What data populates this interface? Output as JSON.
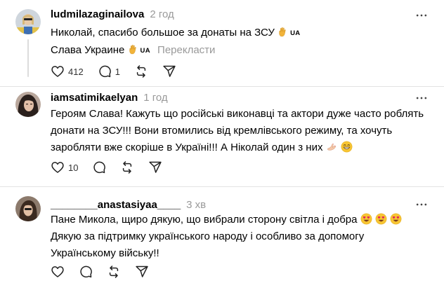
{
  "comments": [
    {
      "username": "ludmilazaginailova",
      "time": "2 год",
      "lines": [
        "Николай, спасибо большое за донаты на ЗСУ",
        "Слава Украине"
      ],
      "flag_label": "UA",
      "translate_label": "Перекласти",
      "likes": "412",
      "replies": "1"
    },
    {
      "username": "iamsatimikaelyan",
      "time": "1 год",
      "lines": [
        "Героям Слава! Кажуть що російські виконавці та актори дуже часто роблять",
        "донати на ЗСУ!!! Вони втомились від кремлівського режиму, та хочуть",
        "заробляти вже скоріше в Україні!!! А Ніколай один з них"
      ],
      "likes": "10"
    },
    {
      "username": "________anastasiyaa____",
      "time": "3 хв",
      "lines": [
        "Пане Микола, щиро дякую, що вибрали сторону світла і добра",
        "Дякую за підтримку українського народу і особливо за допомогу",
        "Українському війську!!"
      ]
    }
  ],
  "icons": {
    "more": "more-horizontal-icon",
    "like": "heart-icon",
    "reply": "comment-icon",
    "repost": "repost-icon",
    "share": "send-icon"
  },
  "colors": {
    "muted": "#999999",
    "divider": "#e3e3e3",
    "thread_line": "#dcdcdc"
  }
}
